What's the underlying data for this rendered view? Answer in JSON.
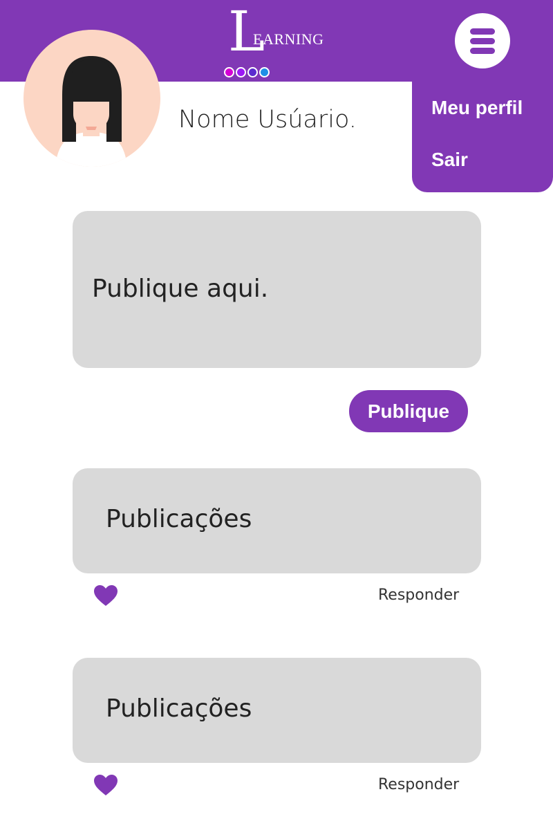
{
  "header": {
    "logo_initial": "L",
    "logo_rest": "EARNING",
    "dot_colors": [
      "#d400d4",
      "#9b19f5",
      "#5b2ccf",
      "#1f8fe6"
    ],
    "background": "#8138b5"
  },
  "menu": {
    "icon": "hamburger-menu-icon",
    "items": [
      {
        "label": "Meu perfil"
      },
      {
        "label": "Sair"
      }
    ]
  },
  "profile": {
    "name": "Nome Usúario."
  },
  "composer": {
    "placeholder": "Publique aqui.",
    "submit_label": "Publique"
  },
  "posts": [
    {
      "text": "Publicações",
      "like_icon": "heart-icon",
      "reply_label": "Responder"
    },
    {
      "text": "Publicações",
      "like_icon": "heart-icon",
      "reply_label": "Responder"
    }
  ],
  "colors": {
    "accent": "#8138b5",
    "card": "#d9d9d9"
  }
}
